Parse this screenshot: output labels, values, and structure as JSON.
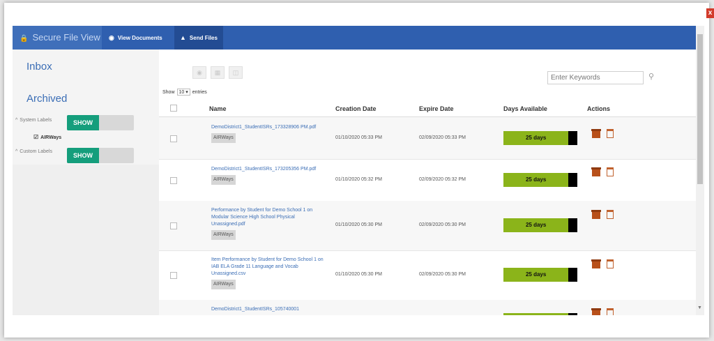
{
  "window": {
    "close_label": "x"
  },
  "header": {
    "brand": "Secure File View",
    "nav": [
      {
        "label": "View Documents",
        "icon": "eye-icon"
      },
      {
        "label": "Send Files",
        "icon": "upload-icon"
      }
    ]
  },
  "sidebar": {
    "inbox": "Inbox",
    "archived": "Archived",
    "system_labels": "System Labels",
    "custom_labels": "Custom Labels",
    "show": "SHOW",
    "airways": "AIRWays"
  },
  "toolbar": {
    "search_placeholder": "Enter Keywords",
    "show": "Show",
    "entries_value": "10",
    "entries": "entries"
  },
  "table": {
    "headers": {
      "name": "Name",
      "creation": "Creation Date",
      "expire": "Expire Date",
      "days": "Days Available",
      "actions": "Actions"
    },
    "rows": [
      {
        "name": "DemoDistrict1_StudentISRs_173328906 PM.pdf",
        "tag": "AIRWays",
        "created": "01/10/2020 05:33 PM",
        "expires": "02/09/2020 05:33 PM",
        "days": "25 days",
        "days_fraction": 0.88
      },
      {
        "name": "DemoDistrict1_StudentISRs_173205356 PM.pdf",
        "tag": "AIRWays",
        "created": "01/10/2020 05:32 PM",
        "expires": "02/09/2020 05:32 PM",
        "days": "25 days",
        "days_fraction": 0.88
      },
      {
        "name": "Performance by Student for Demo School 1 on Modular Science High School Physical Unassigned.pdf",
        "tag": "AIRWays",
        "created": "01/10/2020 05:30 PM",
        "expires": "02/09/2020 05:30 PM",
        "days": "25 days",
        "days_fraction": 0.88
      },
      {
        "name": "Item Performance by Student for Demo School 1 on IAB ELA Grade 11 Language and Vocab Unassigned.csv",
        "tag": "AIRWays",
        "created": "01/10/2020 05:30 PM",
        "expires": "02/09/2020 05:30 PM",
        "days": "25 days",
        "days_fraction": 0.88
      },
      {
        "name": "DemoDistrict1_StudentISRs_105740001",
        "tag": "",
        "created": "",
        "expires": "",
        "days": "",
        "days_fraction": 0.88
      }
    ]
  }
}
